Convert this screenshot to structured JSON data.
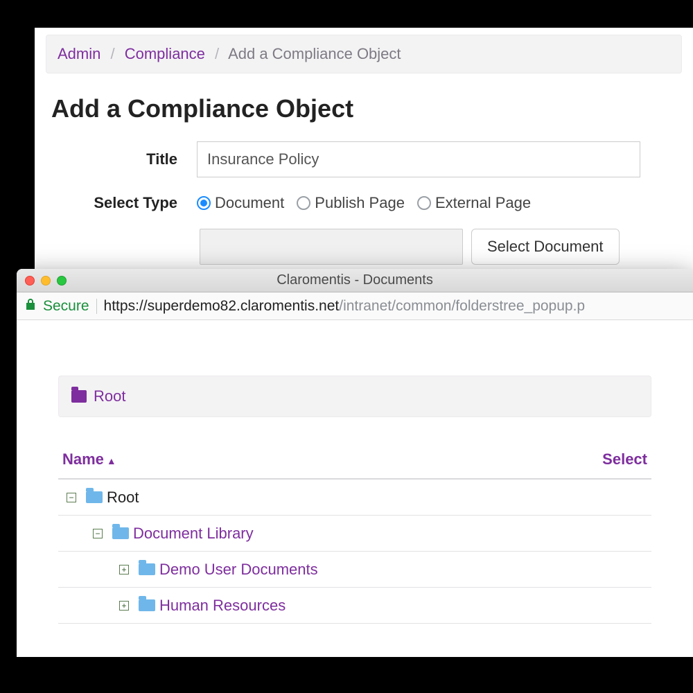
{
  "breadcrumb": {
    "admin": "Admin",
    "compliance": "Compliance",
    "current": "Add a Compliance Object"
  },
  "page": {
    "title": "Add a Compliance Object"
  },
  "form": {
    "title_label": "Title",
    "title_value": "Insurance Policy",
    "type_label": "Select Type",
    "options": {
      "document": "Document",
      "publish_page": "Publish Page",
      "external_page": "External Page"
    },
    "selected": "document",
    "select_button": "Select Document"
  },
  "popup": {
    "window_title": "Claromentis - Documents",
    "secure_label": "Secure",
    "url_host": "https://superdemo82.claromentis.net",
    "url_path": "/intranet/common/folderstree_popup.p",
    "root_label": "Root",
    "columns": {
      "name": "Name",
      "select": "Select"
    },
    "tree": {
      "root": "Root",
      "doc_library": "Document Library",
      "demo_user_docs": "Demo User Documents",
      "human_resources": "Human Resources"
    }
  }
}
